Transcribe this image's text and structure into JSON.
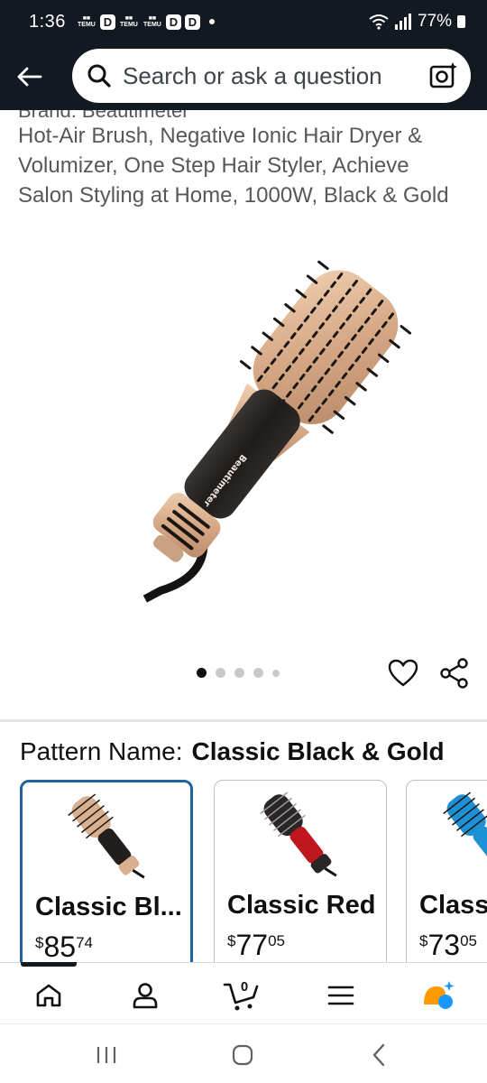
{
  "status_bar": {
    "time": "1:36",
    "notification_apps": [
      "TEMU",
      "TEMU",
      "TEMU"
    ],
    "battery": "77%"
  },
  "search": {
    "placeholder": "Search or ask a question"
  },
  "product": {
    "title_cut_off": "Brand: Beautimeter",
    "title": "Hot-Air Brush, Negative Ionic Hair Dryer & Volumizer, One Step Hair Styler, Achieve Salon Styling at Home, 1000W, Black & Gold",
    "image_brand_text": "Beautimeter",
    "carousel": {
      "total": 5,
      "active_index": 0
    }
  },
  "pattern": {
    "label": "Pattern Name:",
    "selected": "Classic Black & Gold",
    "options": [
      {
        "name": "Classic Bl...",
        "currency": "$",
        "whole": "85",
        "fraction": "74",
        "color": "black-gold",
        "selected": true
      },
      {
        "name": "Classic Red",
        "currency": "$",
        "whole": "77",
        "fraction": "05",
        "color": "red",
        "selected": false
      },
      {
        "name": "Classi",
        "currency": "$",
        "whole": "73",
        "fraction": "05",
        "color": "blue",
        "selected": false
      }
    ]
  },
  "bottom_nav": {
    "items": [
      "home-icon",
      "account-icon",
      "cart-icon",
      "menu-icon",
      "rufus-icon"
    ],
    "cart_count": "0",
    "active": "home"
  },
  "colors": {
    "header_bg": "#131921",
    "selected_border": "#2162a1",
    "text": "#0f1111",
    "muted_text": "#565959",
    "rufus_orange": "#ff9900",
    "rufus_blue": "#1a98ff"
  }
}
